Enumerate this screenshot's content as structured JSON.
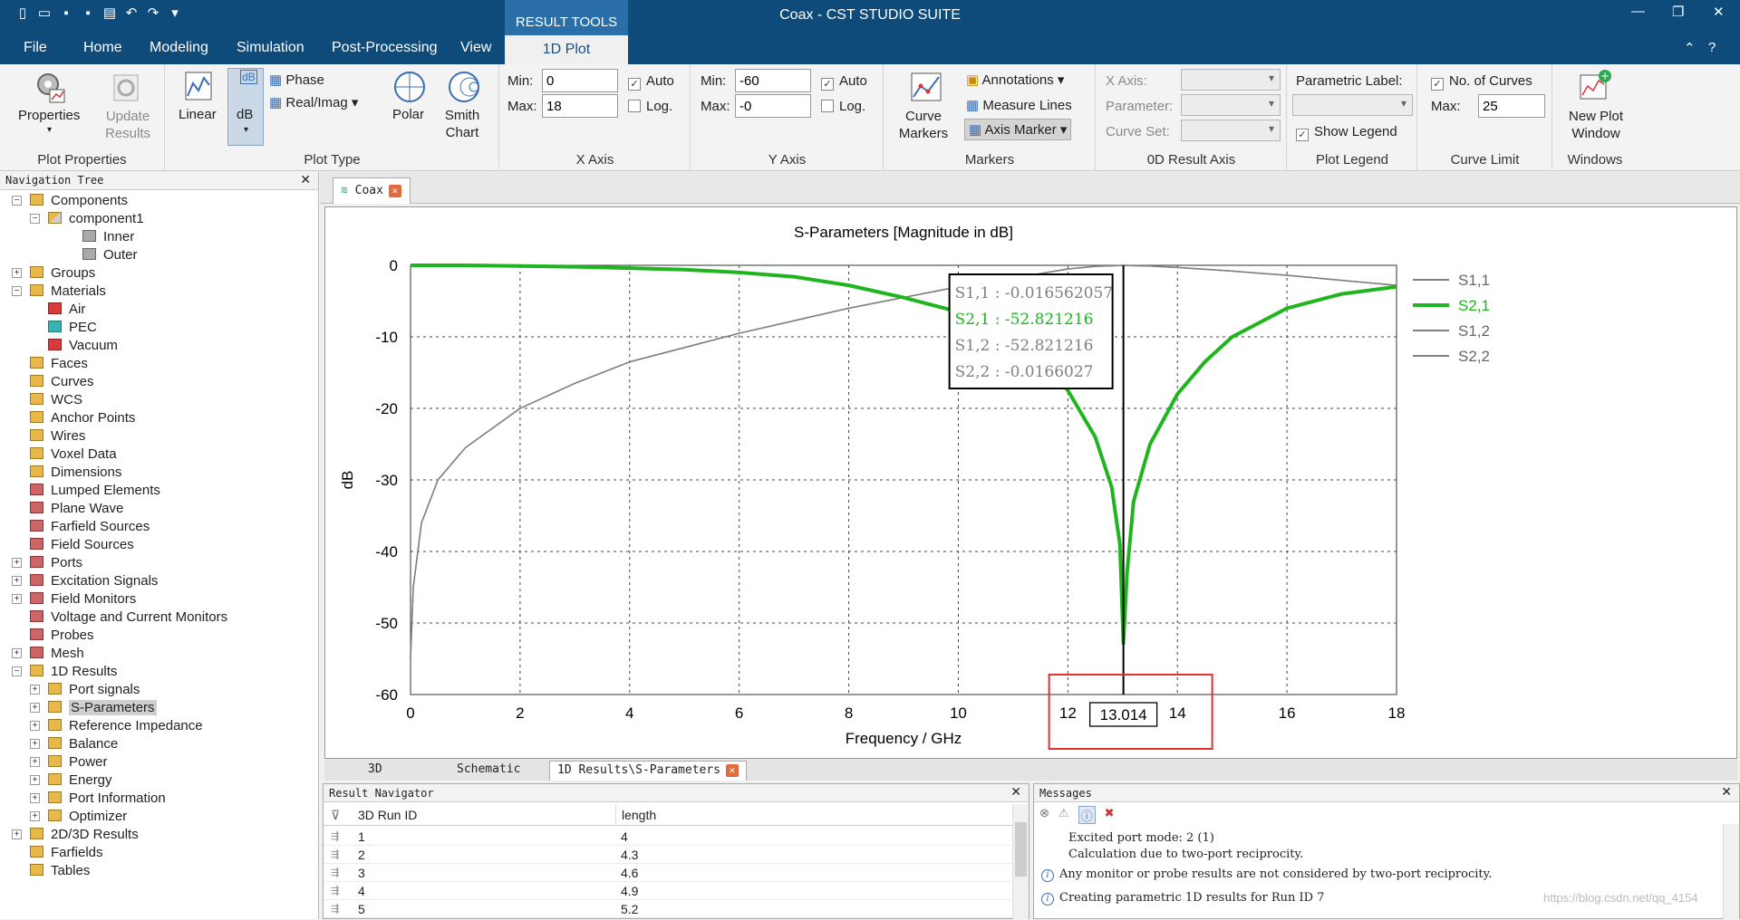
{
  "window": {
    "title": "Coax - CST STUDIO SUITE",
    "context_tab_group": "RESULT TOOLS",
    "context_tab": "1D Plot"
  },
  "menu": [
    "File",
    "Home",
    "Modeling",
    "Simulation",
    "Post-Processing",
    "View"
  ],
  "ribbon": {
    "plot_properties": {
      "label": "Plot Properties",
      "properties": "Properties",
      "update_results": "Update Results"
    },
    "plot_type": {
      "label": "Plot Type",
      "linear": "Linear",
      "db": "dB",
      "phase": "Phase",
      "real_imag": "Real/Imag",
      "polar": "Polar",
      "smith": "Smith Chart"
    },
    "x_axis": {
      "label": "X Axis",
      "min_label": "Min:",
      "min": "0",
      "max_label": "Max:",
      "max": "18",
      "auto": "Auto",
      "log": "Log.",
      "auto_checked": true
    },
    "y_axis": {
      "label": "Y Axis",
      "min_label": "Min:",
      "min": "-60",
      "max_label": "Max:",
      "max": "-0",
      "auto": "Auto",
      "log": "Log.",
      "auto_checked": true
    },
    "markers": {
      "label": "Markers",
      "curve_markers": "Curve Markers",
      "annotations": "Annotations",
      "measure_lines": "Measure Lines",
      "axis_marker": "Axis Marker"
    },
    "result_axis_0d": {
      "label": "0D Result Axis",
      "x_axis": "X Axis:",
      "parameter": "Parameter:",
      "curve_set": "Curve Set:"
    },
    "plot_legend": {
      "label": "Plot Legend",
      "parametric_label": "Parametric Label:",
      "show_legend": "Show Legend"
    },
    "curve_limit": {
      "label": "Curve Limit",
      "no_of_curves": "No. of Curves",
      "max_label": "Max:",
      "max": "25"
    },
    "windows": {
      "label": "Windows",
      "new_plot_window": "New Plot Window"
    }
  },
  "nav_tree": {
    "title": "Navigation Tree",
    "items": [
      {
        "label": "Components"
      },
      {
        "label": "component1"
      },
      {
        "label": "Inner"
      },
      {
        "label": "Outer"
      },
      {
        "label": "Groups"
      },
      {
        "label": "Materials"
      },
      {
        "label": "Air"
      },
      {
        "label": "PEC"
      },
      {
        "label": "Vacuum"
      },
      {
        "label": "Faces"
      },
      {
        "label": "Curves"
      },
      {
        "label": "WCS"
      },
      {
        "label": "Anchor Points"
      },
      {
        "label": "Wires"
      },
      {
        "label": "Voxel Data"
      },
      {
        "label": "Dimensions"
      },
      {
        "label": "Lumped Elements"
      },
      {
        "label": "Plane Wave"
      },
      {
        "label": "Farfield Sources"
      },
      {
        "label": "Field Sources"
      },
      {
        "label": "Ports"
      },
      {
        "label": "Excitation Signals"
      },
      {
        "label": "Field Monitors"
      },
      {
        "label": "Voltage and Current Monitors"
      },
      {
        "label": "Probes"
      },
      {
        "label": "Mesh"
      },
      {
        "label": "1D Results"
      },
      {
        "label": "Port signals"
      },
      {
        "label": "S-Parameters"
      },
      {
        "label": "Reference Impedance"
      },
      {
        "label": "Balance"
      },
      {
        "label": "Power"
      },
      {
        "label": "Energy"
      },
      {
        "label": "Port Information"
      },
      {
        "label": "Optimizer"
      },
      {
        "label": "2D/3D Results"
      },
      {
        "label": "Farfields"
      },
      {
        "label": "Tables"
      }
    ]
  },
  "doc_tab": "Coax",
  "bottom_tabs": [
    "3D",
    "Schematic",
    "1D Results\\S-Parameters"
  ],
  "chart_data": {
    "type": "line",
    "title": "S-Parameters [Magnitude in dB]",
    "xlabel": "Frequency / GHz",
    "ylabel": "dB",
    "xlim": [
      0,
      18
    ],
    "ylim": [
      -60,
      0
    ],
    "x_ticks": [
      "0",
      "2",
      "4",
      "6",
      "8",
      "10",
      "12",
      "14",
      "16",
      "18"
    ],
    "y_ticks": [
      "0",
      "-10",
      "-20",
      "-30",
      "-40",
      "-50",
      "-60"
    ],
    "grid": true,
    "legend_position": "right",
    "marker_x": 13.014,
    "marker_label": "13.014",
    "colors": {
      "s11": "#808080",
      "s21": "#1fb51f",
      "s12": "#808080",
      "s22": "#808080"
    },
    "series": [
      {
        "name": "S1,1",
        "x": [
          0,
          0.05,
          0.2,
          0.5,
          1,
          2,
          3,
          4,
          6,
          8,
          10,
          11,
          12,
          12.5,
          13,
          13.014,
          13.5,
          14,
          15,
          16,
          17,
          18
        ],
        "values": [
          -55,
          -45,
          -36,
          -30,
          -25.5,
          -20,
          -16.5,
          -13.5,
          -9.5,
          -6,
          -3,
          -1.8,
          -0.5,
          -0.15,
          -0.02,
          -0.0166,
          -0.1,
          -0.3,
          -0.8,
          -1.4,
          -2.1,
          -2.8
        ]
      },
      {
        "name": "S2,1",
        "x": [
          0,
          1,
          2,
          3,
          4,
          5,
          6,
          7,
          8,
          9,
          10,
          10.5,
          11,
          11.5,
          12,
          12.5,
          12.8,
          12.95,
          13.014,
          13.08,
          13.2,
          13.5,
          14,
          14.5,
          15,
          16,
          17,
          18
        ],
        "values": [
          0,
          0,
          -0.1,
          -0.2,
          -0.4,
          -0.6,
          -1,
          -1.6,
          -2.8,
          -4.5,
          -6.5,
          -8,
          -10.5,
          -13,
          -17.5,
          -24,
          -31,
          -39,
          -52.82,
          -43,
          -33,
          -25,
          -18,
          -13.5,
          -10,
          -6,
          -4,
          -3
        ]
      },
      {
        "name": "S1,2",
        "x": [
          0,
          1,
          2,
          3,
          4,
          5,
          6,
          7,
          8,
          9,
          10,
          10.5,
          11,
          11.5,
          12,
          12.5,
          12.8,
          12.95,
          13.014,
          13.08,
          13.2,
          13.5,
          14,
          14.5,
          15,
          16,
          17,
          18
        ],
        "values": [
          0,
          0,
          -0.1,
          -0.2,
          -0.4,
          -0.6,
          -1,
          -1.6,
          -2.8,
          -4.5,
          -6.5,
          -8,
          -10.5,
          -13,
          -17.5,
          -24,
          -31,
          -39,
          -52.82,
          -43,
          -33,
          -25,
          -18,
          -13.5,
          -10,
          -6,
          -4,
          -3
        ]
      },
      {
        "name": "S2,2",
        "x": [
          0,
          0.05,
          0.2,
          0.5,
          1,
          2,
          3,
          4,
          6,
          8,
          10,
          11,
          12,
          12.5,
          13,
          13.014,
          13.5,
          14,
          15,
          16,
          17,
          18
        ],
        "values": [
          -55,
          -45,
          -36,
          -30,
          -25.5,
          -20,
          -16.5,
          -13.5,
          -9.5,
          -6,
          -3,
          -1.8,
          -0.5,
          -0.15,
          -0.02,
          -0.0166,
          -0.1,
          -0.3,
          -0.8,
          -1.4,
          -2.1,
          -2.8
        ]
      }
    ],
    "marker_readout": [
      {
        "text": "S1,1 : -0.016562057",
        "color": "#808080"
      },
      {
        "text": "S2,1 : -52.821216",
        "color": "#1fb51f"
      },
      {
        "text": "S1,2 : -52.821216",
        "color": "#808080"
      },
      {
        "text": "S2,2 : -0.0166027",
        "color": "#808080"
      }
    ]
  },
  "result_navigator": {
    "title": "Result Navigator",
    "columns": [
      "3D Run ID",
      "length"
    ],
    "rows": [
      [
        "1",
        "4"
      ],
      [
        "2",
        "4.3"
      ],
      [
        "3",
        "4.6"
      ],
      [
        "4",
        "4.9"
      ],
      [
        "5",
        "5.2"
      ]
    ]
  },
  "messages": {
    "title": "Messages",
    "lines": [
      "Excited port mode: 2 (1)",
      "Calculation due to two-port reciprocity.",
      "Any monitor or probe results are not considered by two-port reciprocity.",
      "Creating parametric 1D results for Run ID 7"
    ],
    "watermark": "https://blog.csdn.net/qq_4154"
  }
}
